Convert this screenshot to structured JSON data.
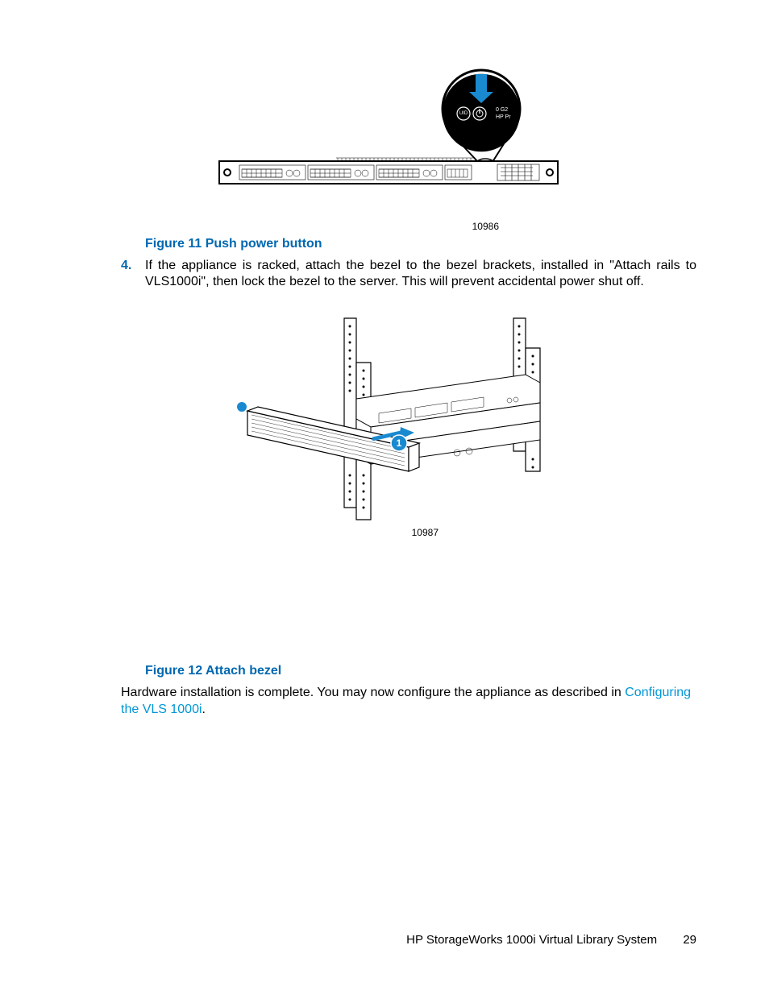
{
  "figure11": {
    "id": "10986",
    "caption": "Figure 11 Push power button",
    "bubble": {
      "uid": "UID",
      "label": "0 G2",
      "brand": "HP Pr"
    }
  },
  "step4": {
    "num": "4.",
    "text": "If the appliance is racked, attach the bezel to the bezel brackets, installed in \"Attach rails to VLS1000i\", then lock the bezel to the server. This will prevent accidental power shut off."
  },
  "figure12": {
    "id": "10987",
    "caption": "Figure 12 Attach bezel",
    "callout": "1"
  },
  "closing": {
    "pre": "Hardware installation is complete. You may now configure the appliance as described in ",
    "link": "Configuring the VLS 1000i",
    "post": "."
  },
  "footer": {
    "title": "HP StorageWorks 1000i Virtual Library System",
    "page": "29"
  }
}
